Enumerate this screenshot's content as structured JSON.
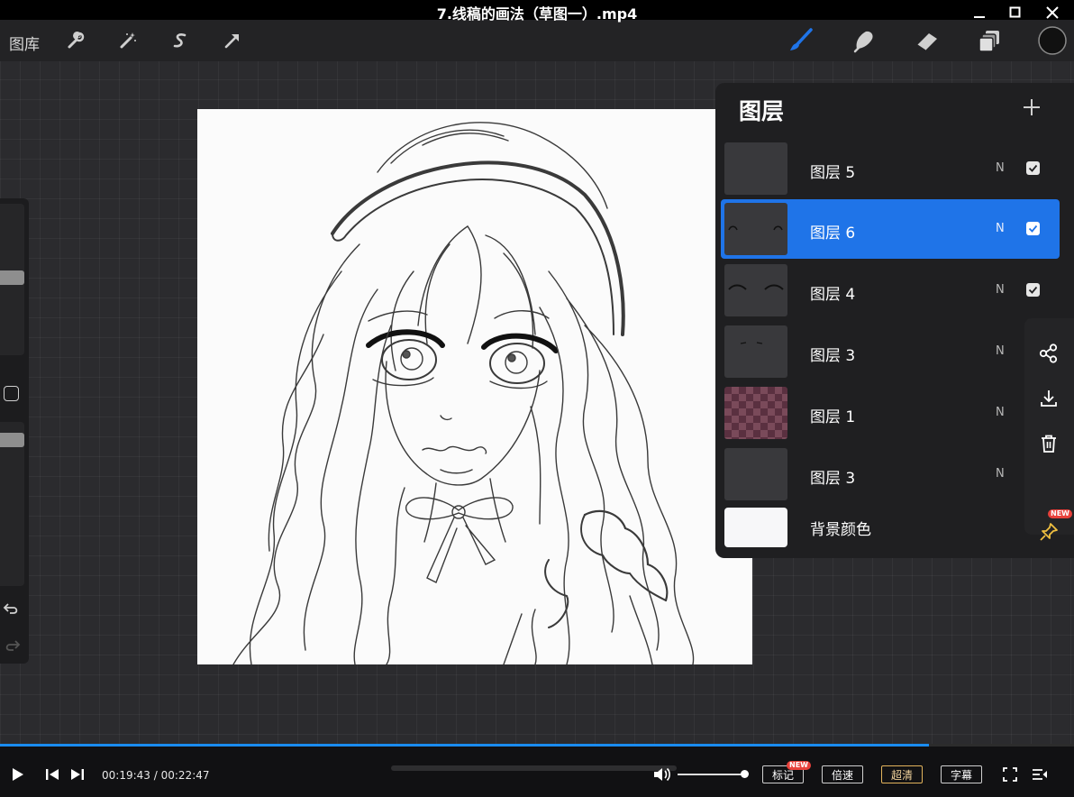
{
  "window": {
    "title": "7.线稿的画法（草图一）.mp4",
    "controls": [
      "minimize-icon",
      "maximize-icon",
      "close-icon"
    ]
  },
  "app": {
    "toolbar": {
      "gallery_label": "图库",
      "left_tools": [
        "wrench-icon",
        "magic-wand-icon",
        "selection-s-icon",
        "transform-arrow-icon"
      ],
      "right_tools": [
        "brush-icon",
        "smudge-icon",
        "eraser-icon",
        "layers-icon"
      ],
      "active_tool": "brush-icon",
      "current_color": "#111111",
      "accent_color": "#1f74e8"
    },
    "left_sidebar": {
      "controls": [
        "brush-size-slider",
        "modify-square-button",
        "opacity-slider",
        "undo-icon",
        "redo-icon"
      ]
    },
    "layers_panel": {
      "title": "图层",
      "add_icon": "plus-icon",
      "layers": [
        {
          "name": "图层 5",
          "mode": "N",
          "visible": true,
          "active": false
        },
        {
          "name": "图层 6",
          "mode": "N",
          "visible": true,
          "active": true
        },
        {
          "name": "图层 4",
          "mode": "N",
          "visible": true,
          "active": false
        },
        {
          "name": "图层 3",
          "mode": "N",
          "visible": true,
          "active": false
        },
        {
          "name": "图层 1",
          "mode": "N",
          "visible": false,
          "active": false
        },
        {
          "name": "图层 3",
          "mode": "N",
          "visible": false,
          "active": false
        },
        {
          "name": "背景颜色",
          "mode": "",
          "visible": false,
          "active": false
        }
      ]
    },
    "side_actions": {
      "items": [
        "share-icon",
        "download-icon",
        "trash-icon",
        "pin-icon"
      ],
      "new_badge": "NEW"
    }
  },
  "player": {
    "current_time": "00:19:43",
    "separator": "/",
    "total_time": "00:22:47",
    "progress": 0.865,
    "volume": 1.0,
    "buttons": {
      "bookmark": "标记",
      "bookmark_badge": "NEW",
      "speed": "倍速",
      "quality": "超清",
      "subtitles": "字幕"
    }
  }
}
